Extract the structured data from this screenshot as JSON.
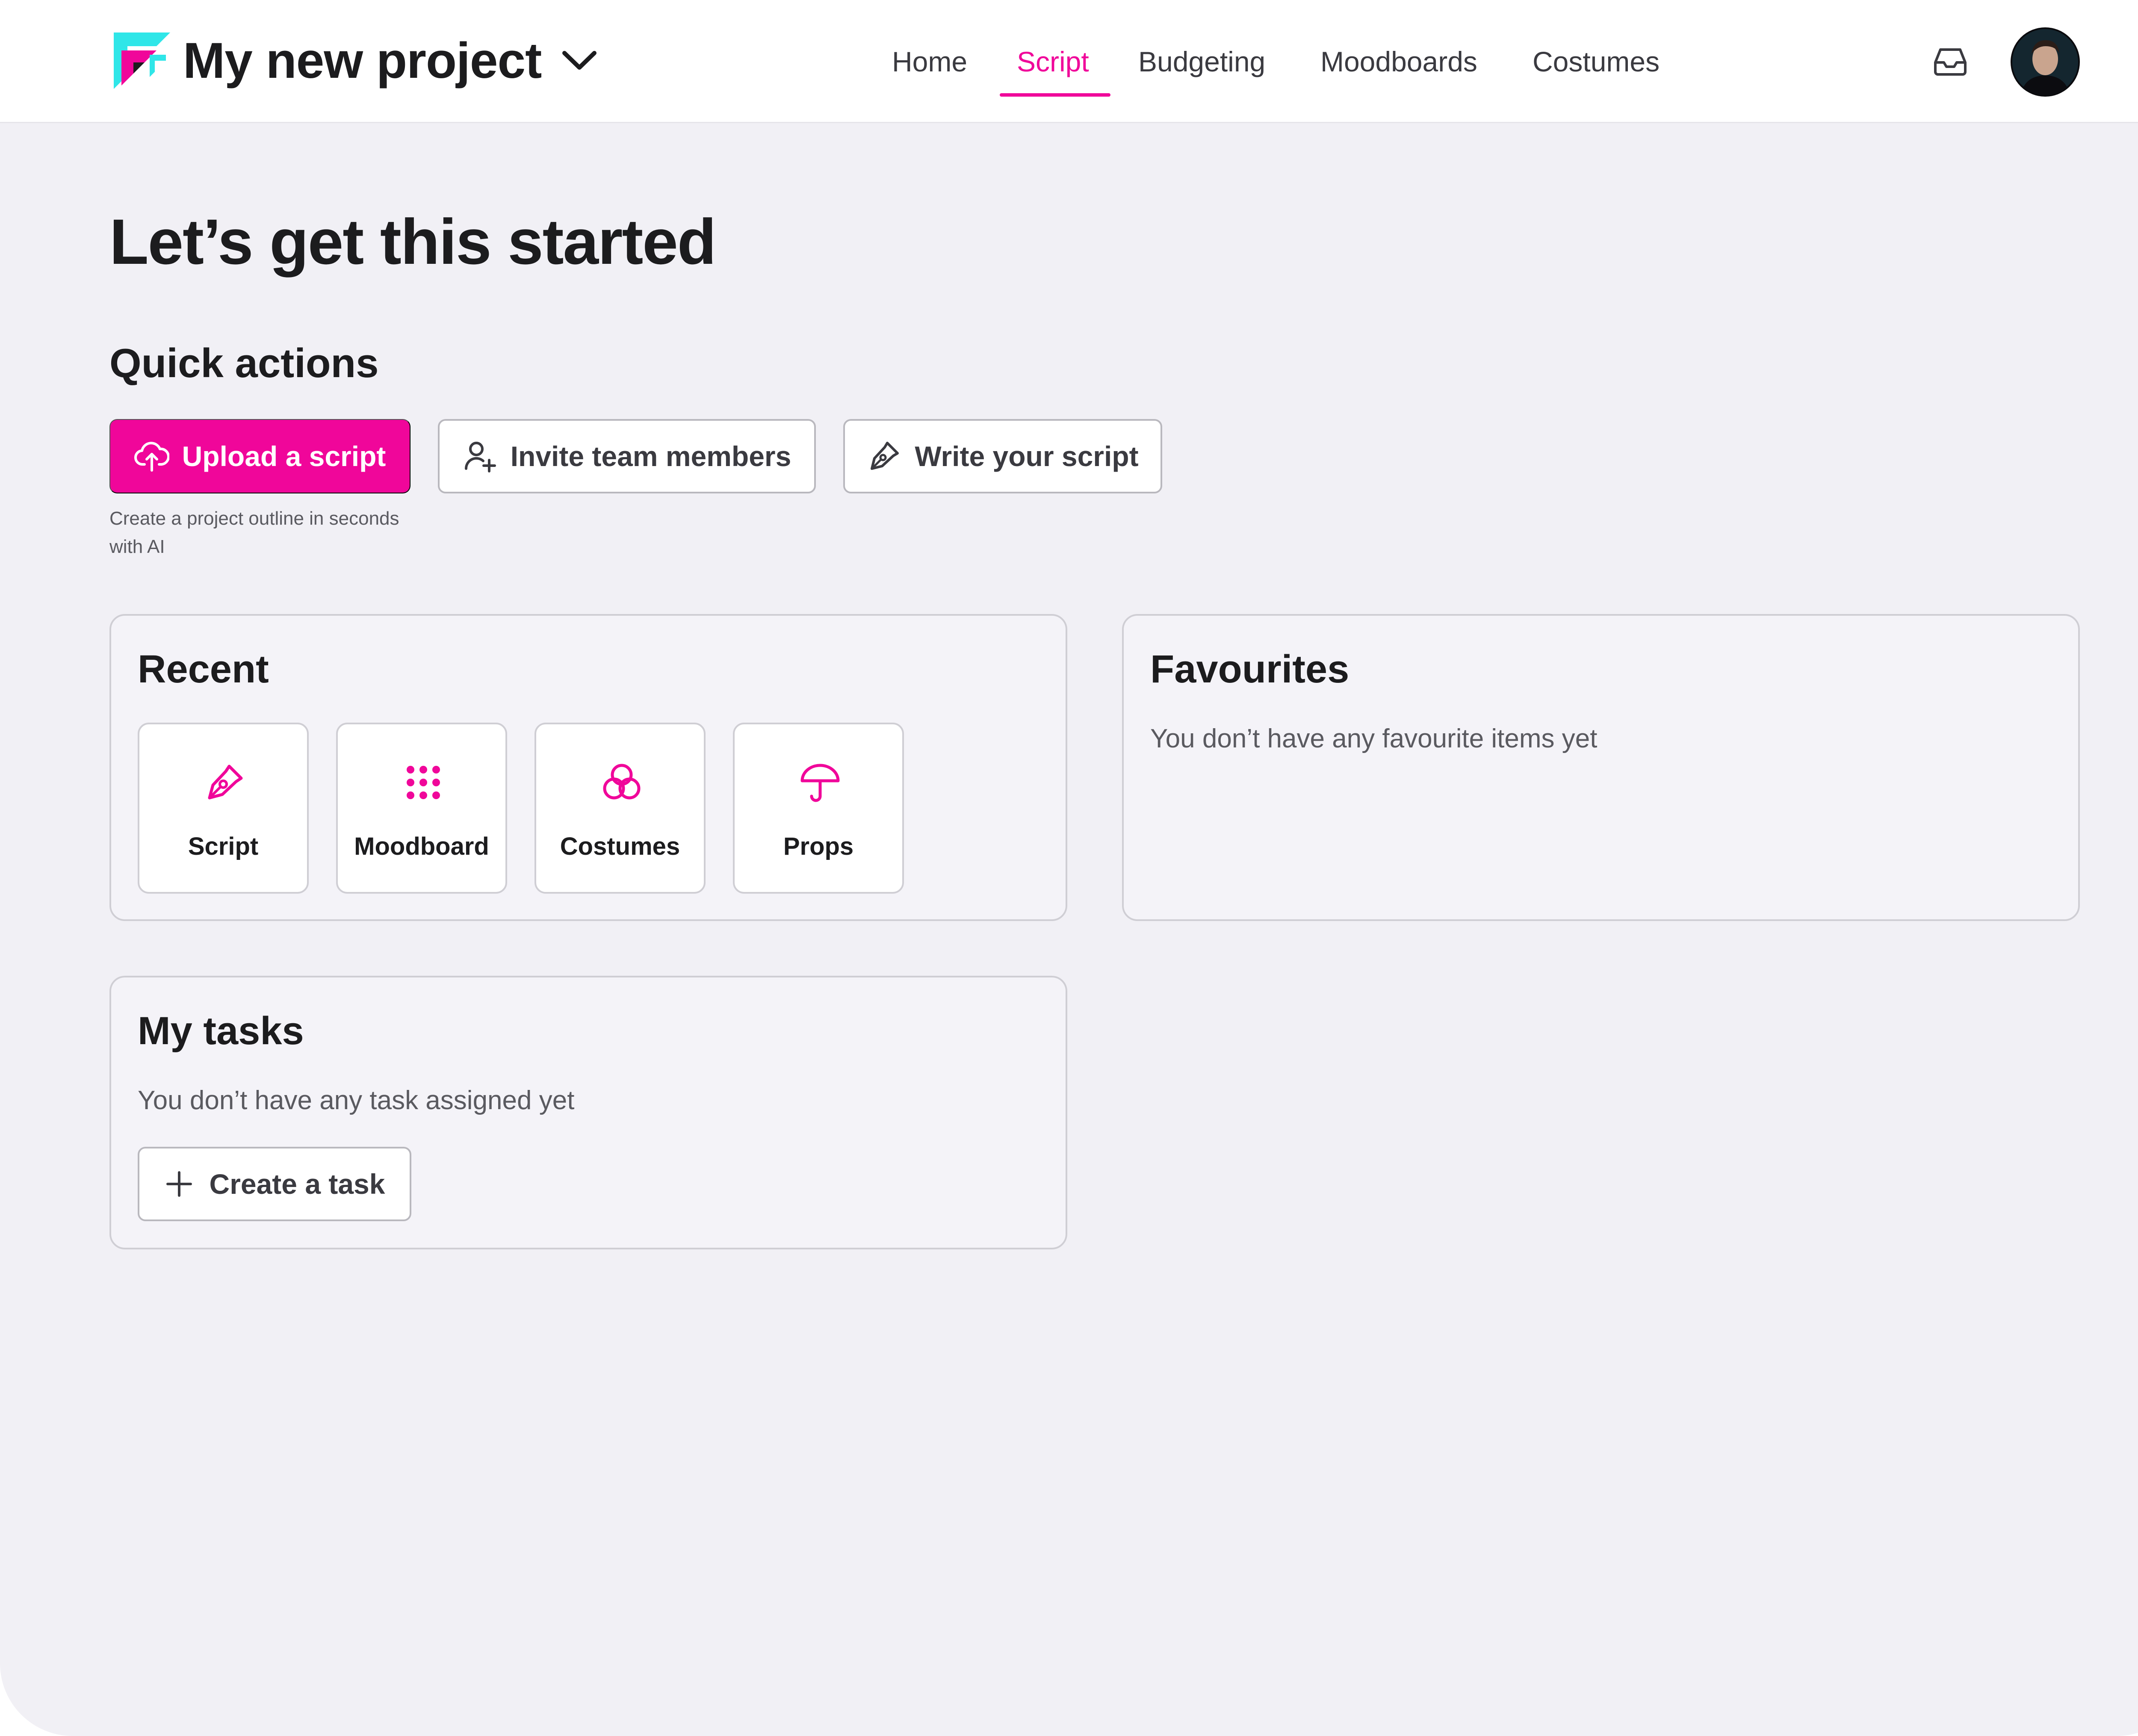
{
  "header": {
    "project_title": "My new project",
    "nav": [
      {
        "label": "Home",
        "active": false
      },
      {
        "label": "Script",
        "active": true
      },
      {
        "label": "Budgeting",
        "active": false
      },
      {
        "label": "Moodboards",
        "active": false
      },
      {
        "label": "Costumes",
        "active": false
      }
    ],
    "icons": {
      "logo": "project-logo",
      "dropdown": "chevron-down-icon",
      "inbox": "inbox-icon",
      "avatar": "user-avatar"
    }
  },
  "main": {
    "title": "Let’s get this started",
    "quick_actions": {
      "heading": "Quick actions",
      "upload": {
        "label": "Upload a script",
        "icon": "cloud-upload-icon",
        "helper": "Create a project outline in seconds with AI"
      },
      "invite": {
        "label": "Invite team members",
        "icon": "user-plus-icon"
      },
      "write": {
        "label": "Write your script",
        "icon": "pen-icon"
      }
    },
    "recent": {
      "heading": "Recent",
      "items": [
        {
          "label": "Script",
          "icon": "pen-icon"
        },
        {
          "label": "Moodboard",
          "icon": "grid-dots-icon"
        },
        {
          "label": "Costumes",
          "icon": "circles-icon"
        },
        {
          "label": "Props",
          "icon": "umbrella-icon"
        }
      ]
    },
    "favourites": {
      "heading": "Favourites",
      "empty": "You don’t have any favourite items yet"
    },
    "tasks": {
      "heading": "My tasks",
      "empty": "You don’t have any task assigned yet",
      "create_label": "Create a task"
    }
  },
  "colors": {
    "accent": "#f0069a",
    "logo_cyan": "#2fe6e8",
    "background": "#f1f0f5",
    "text": "#1c1c1e",
    "muted": "#5a5a60"
  }
}
